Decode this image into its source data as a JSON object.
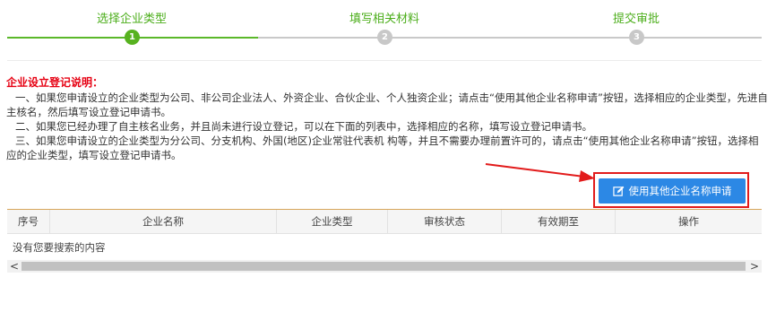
{
  "stepper": {
    "steps": [
      {
        "label": "选择企业类型",
        "number": "1",
        "state": "active"
      },
      {
        "label": "填写相关材料",
        "number": "2",
        "state": "todo"
      },
      {
        "label": "提交审批",
        "number": "3",
        "state": "todo"
      }
    ]
  },
  "instructions": {
    "title": "企业设立登记说明：",
    "lines": [
      "一、如果您申请设立的企业类型为公司、非公司企业法人、外资企业、合伙企业、个人独资企业；请点击“使用其他企业名称申请”按钮，选择相应的企业类型，先进自主核名，然后填写设立登记申请书。",
      "二、如果您已经办理了自主核名业务，并且尚未进行设立登记，可以在下面的列表中，选择相应的名称，填写设立登记申请书。",
      "三、如果您申请设立的企业类型为分公司、分支机构、外国(地区)企业常驻代表机 构等，并且不需要办理前置许可的，请点击“使用其他企业名称申请”按钮，选择相应的企业类型，填写设立登记申请书。"
    ]
  },
  "action_button": {
    "label": "使用其他企业名称申请",
    "icon": "edit-icon"
  },
  "table": {
    "columns": [
      "序号",
      "企业名称",
      "企业类型",
      "审核状态",
      "有效期至",
      "操作"
    ],
    "empty_text": "没有您要搜索的内容"
  },
  "scrollbar": {
    "left_arrow": "<",
    "right_arrow": ">"
  },
  "colors": {
    "accent_green": "#57b21f",
    "button_blue": "#2c88e5",
    "highlight_red": "#e21b1b",
    "title_red": "#e60012"
  }
}
